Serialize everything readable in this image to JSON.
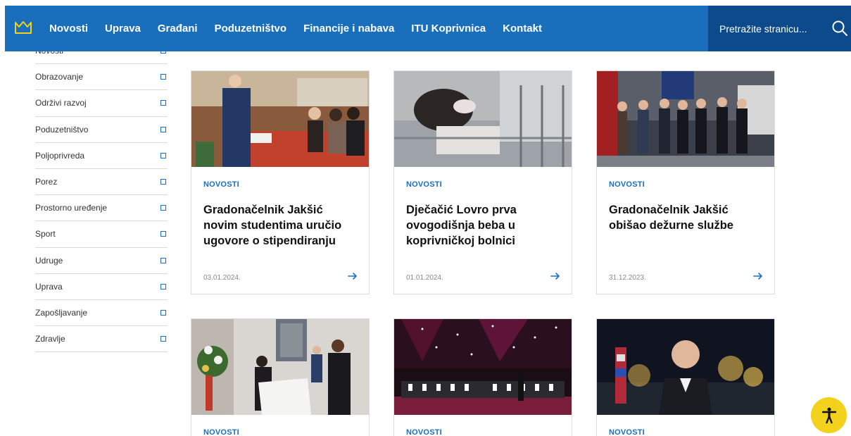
{
  "header": {
    "logo_icon": "crown-icon",
    "nav": [
      {
        "label": "Novosti"
      },
      {
        "label": "Uprava"
      },
      {
        "label": "Građani"
      },
      {
        "label": "Poduzetništvo"
      },
      {
        "label": "Financije i nabava"
      },
      {
        "label": "ITU Koprivnica"
      },
      {
        "label": "Kontakt"
      }
    ],
    "search_placeholder": "Pretražite stranicu...",
    "search_icon": "search-icon",
    "colors": {
      "bar": "#1a6fbd",
      "search_bg": "#0d4a8c"
    }
  },
  "sidebar": {
    "items": [
      {
        "label": "Novosti"
      },
      {
        "label": "Obrazovanje"
      },
      {
        "label": "Održivi razvoj"
      },
      {
        "label": "Poduzetništvo"
      },
      {
        "label": "Poljoprivreda"
      },
      {
        "label": "Porez"
      },
      {
        "label": "Prostorno uređenje"
      },
      {
        "label": "Sport"
      },
      {
        "label": "Udruge"
      },
      {
        "label": "Uprava"
      },
      {
        "label": "Zapošljavanje"
      },
      {
        "label": "Zdravlje"
      }
    ]
  },
  "cards": [
    {
      "category": "NOVOSTI",
      "title": "Gradonačelnik Jakšić novim studentima uručio ugovore o stipendiranju",
      "date": "03.01.2024."
    },
    {
      "category": "NOVOSTI",
      "title": "Dječačić Lovro prva ovogodišnja beba u koprivničkoj bolnici",
      "date": "01.01.2024."
    },
    {
      "category": "NOVOSTI",
      "title": "Gradonačelnik Jakšić obišao dežurne službe",
      "date": "31.12.2023."
    },
    {
      "category": "NOVOSTI",
      "title": "",
      "date": ""
    },
    {
      "category": "NOVOSTI",
      "title": "",
      "date": ""
    },
    {
      "category": "NOVOSTI",
      "title": "",
      "date": ""
    }
  ],
  "accessibility_button": {
    "icon": "accessibility-icon",
    "color": "#f2d21c"
  }
}
